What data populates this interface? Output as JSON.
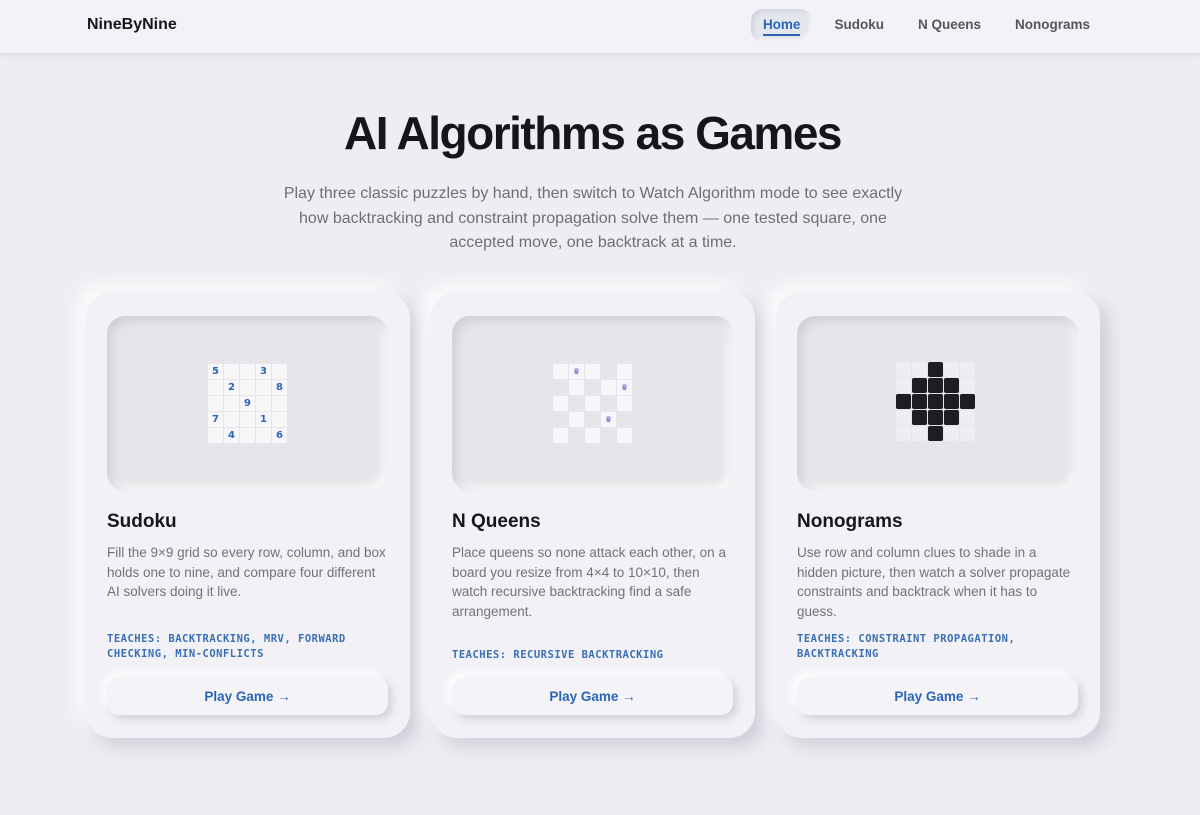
{
  "nav": {
    "brand": "NineByNine",
    "links": [
      {
        "label": "Home",
        "active": true
      },
      {
        "label": "Sudoku",
        "active": false
      },
      {
        "label": "N Queens",
        "active": false
      },
      {
        "label": "Nonograms",
        "active": false
      }
    ]
  },
  "hero": {
    "title": "AI Algorithms as Games",
    "subtitle": "Play three classic puzzles by hand, then switch to Watch Algorithm mode to see exactly how backtracking and constraint propagation solve them — one tested square, one accepted move, one backtrack at a time."
  },
  "cards": [
    {
      "title": "Sudoku",
      "description": "Fill the 9×9 grid so every row, column, and box holds one to nine, and compare four different AI solvers doing it live.",
      "teaches": "TEACHES: BACKTRACKING, MRV, FORWARD CHECKING, MIN-CONFLICTS",
      "button": "Play Game →",
      "preview_cells": [
        "5",
        "",
        "3",
        "",
        "",
        "2",
        "",
        "8",
        "",
        "9",
        "",
        "",
        "7",
        "",
        "1",
        "",
        "4",
        "",
        "",
        "6"
      ]
    },
    {
      "title": "N Queens",
      "description": "Place queens so none attack each other, on a board you resize from 4×4 to 10×10, then watch recursive backtracking find a safe arrangement.",
      "teaches": "TEACHES: RECURSIVE BACKTRACKING",
      "button": "Play Game →",
      "queen_symbol": "♛"
    },
    {
      "title": "Nonograms",
      "description": "Use row and column clues to shade in a hidden picture, then watch a solver propagate constraints and backtrack when it has to guess.",
      "teaches": "TEACHES: CONSTRAINT PROPAGATION, BACKTRACKING",
      "button": "Play Game →",
      "pattern": [
        [
          0,
          0,
          1,
          0,
          0
        ],
        [
          0,
          1,
          1,
          1,
          0
        ],
        [
          1,
          1,
          1,
          1,
          1
        ],
        [
          0,
          1,
          1,
          1,
          0
        ],
        [
          0,
          0,
          1,
          0,
          0
        ]
      ]
    }
  ],
  "colors": {
    "accent": "#2b66b6",
    "background": "#eeedf2",
    "card": "#f2f1f5",
    "queen": "#6a55c8"
  }
}
